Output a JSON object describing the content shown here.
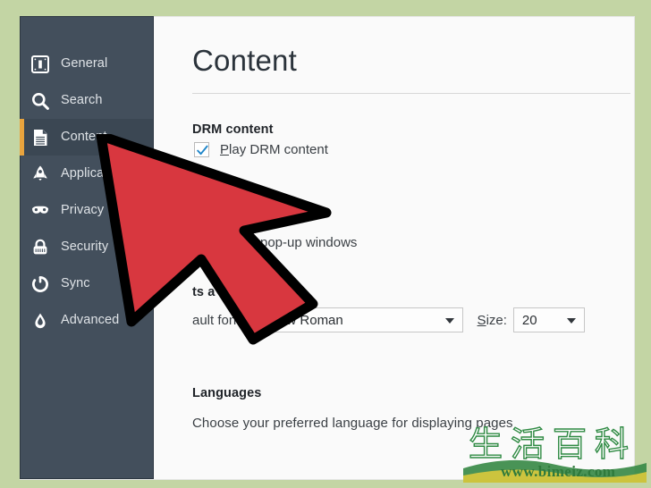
{
  "window": {
    "background_color": "#c3d5a4",
    "panel_color": "#fafafa",
    "sidebar_color": "#434f5c",
    "accent_color": "#e8a33d"
  },
  "sidebar": {
    "items": [
      {
        "label": "General",
        "icon": "general-icon",
        "active": false
      },
      {
        "label": "Search",
        "icon": "search-icon",
        "active": false
      },
      {
        "label": "Content",
        "icon": "content-icon",
        "active": true
      },
      {
        "label": "Applications",
        "icon": "rocket-icon",
        "active": false
      },
      {
        "label": "Privacy",
        "icon": "mask-icon",
        "active": false
      },
      {
        "label": "Security",
        "icon": "lock-icon",
        "active": false
      },
      {
        "label": "Sync",
        "icon": "sync-icon",
        "active": false
      },
      {
        "label": "Advanced",
        "icon": "flask-icon",
        "active": false
      }
    ]
  },
  "main": {
    "title": "Content",
    "drm": {
      "heading": "DRM content",
      "checkbox_label_prefix": "P",
      "checkbox_label_rest": "lay DRM content",
      "checked": true
    },
    "popup": {
      "label": "pop-up windows"
    },
    "fonts": {
      "heading_fragment": "ts a",
      "default_font_label_fragment": "ault font:",
      "font_value_fragment": "s New Roman",
      "size_label_prefix": "S",
      "size_label_rest": "ize:",
      "size_value": "20"
    },
    "languages": {
      "heading": "Languages",
      "description": "Choose your preferred language for displaying pages"
    }
  },
  "watermark": {
    "characters": "生活百科",
    "url": "www.bimeiz.com"
  }
}
